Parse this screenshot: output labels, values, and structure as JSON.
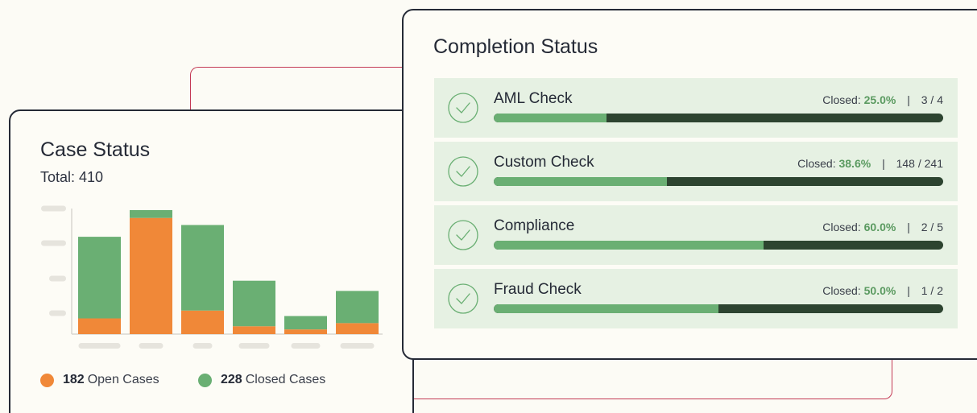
{
  "colors": {
    "open": "#f08838",
    "closed": "#6aaf73",
    "dark_bar": "#2d4430",
    "row_bg": "#e6f1e3",
    "accent_line": "#c43a55",
    "border": "#252a36"
  },
  "case_status": {
    "title": "Case Status",
    "total": "Total: 410",
    "legend": {
      "open_count": "182",
      "open_label": "Open Cases",
      "closed_count": "228",
      "closed_label": "Closed Cases"
    }
  },
  "chart_data": {
    "type": "bar",
    "stacked": true,
    "title": "",
    "xlabel": "",
    "ylabel": "",
    "categories": [
      "",
      "",
      "",
      "",
      "",
      ""
    ],
    "ylim": [
      0,
      160
    ],
    "grid": false,
    "legend_position": "bottom",
    "series": [
      {
        "name": "Open Cases",
        "color": "#f08838",
        "values": [
          20,
          148,
          30,
          10,
          6,
          14
        ]
      },
      {
        "name": "Closed Cases",
        "color": "#6aaf73",
        "values": [
          104,
          10,
          109,
          58,
          17,
          41
        ]
      }
    ]
  },
  "completion_status": {
    "title": "Completion Status",
    "closed_prefix": "Closed:",
    "items": [
      {
        "name": "AML Check",
        "percent": "25.0%",
        "fraction": "3 / 4",
        "progress": 0.25
      },
      {
        "name": "Custom Check",
        "percent": "38.6%",
        "fraction": "148 / 241",
        "progress": 0.386
      },
      {
        "name": "Compliance",
        "percent": "60.0%",
        "fraction": "2 / 5",
        "progress": 0.6
      },
      {
        "name": "Fraud Check",
        "percent": "50.0%",
        "fraction": "1 / 2",
        "progress": 0.5
      }
    ]
  }
}
